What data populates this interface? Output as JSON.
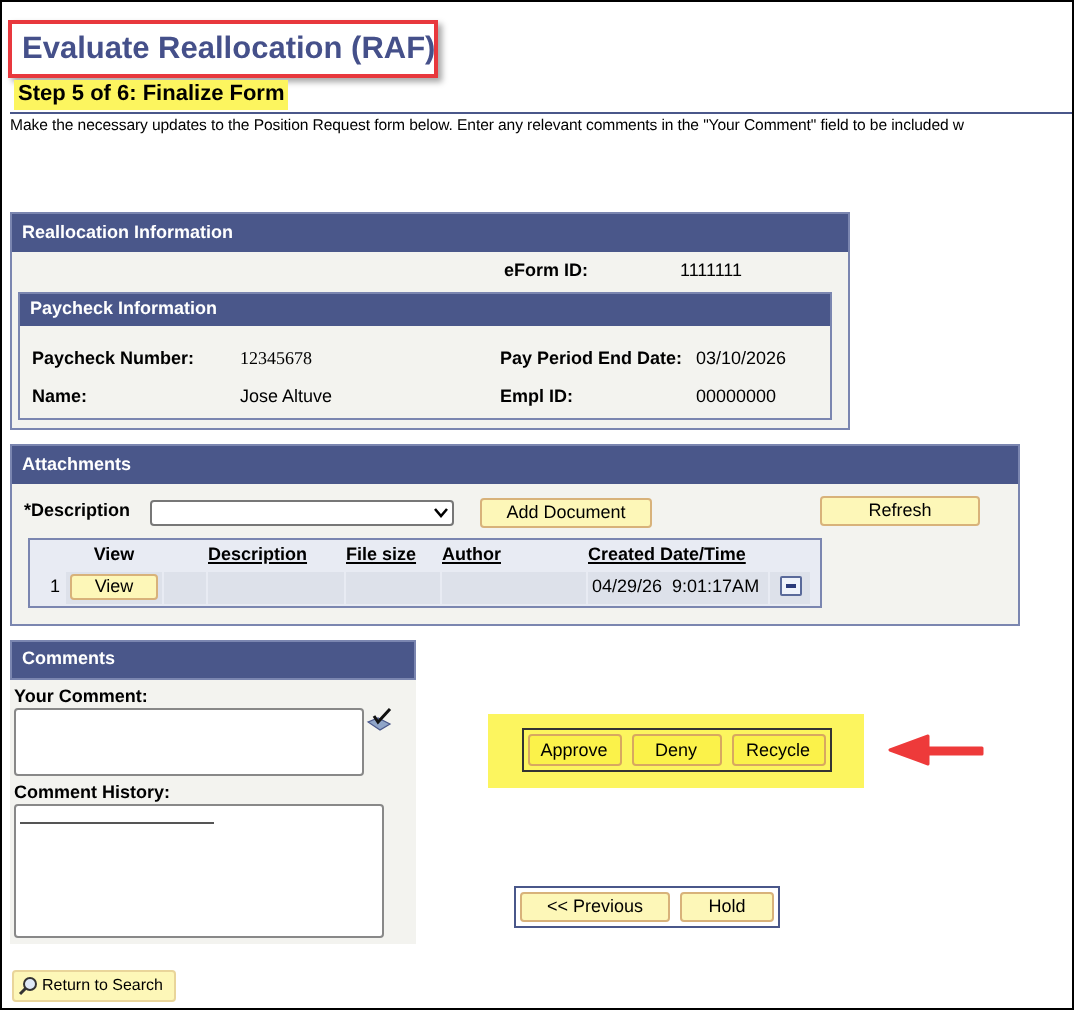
{
  "title": {
    "text": "Evaluate Reallocation (RAF)",
    "outlined": true
  },
  "step": {
    "text": "Step 5 of 6: Finalize Form",
    "highlighted": true
  },
  "instructions": "Make the necessary updates to the Position Request form below. Enter any relevant comments in the \"Your Comment\" field to be included w",
  "reallocation": {
    "heading": "Reallocation Information",
    "eform_id": {
      "label": "eForm ID:",
      "value": "1111111"
    },
    "paycheck": {
      "heading": "Paycheck Information",
      "fields": [
        {
          "label": "Paycheck Number:",
          "value": "12345678"
        },
        {
          "label": "Pay Period End Date:",
          "value": "03/10/2026"
        },
        {
          "label": "Name:",
          "value": "Jose Altuve"
        },
        {
          "label": "Empl ID:",
          "value": "00000000"
        }
      ]
    }
  },
  "attachments": {
    "heading": "Attachments",
    "description_label": "*Description",
    "add_button": "Add Document",
    "refresh_button": "Refresh",
    "table": {
      "columns": [
        {
          "label": "View",
          "link": false
        },
        {
          "label": "Description",
          "link": true
        },
        {
          "label": "File size",
          "link": true
        },
        {
          "label": "Author",
          "link": true
        },
        {
          "label": "Created Date/Time",
          "link": true
        }
      ],
      "rows": [
        {
          "number": "1",
          "view_button": "View",
          "created": "04/29/26  9:01:17AM"
        }
      ]
    }
  },
  "comments": {
    "heading": "Comments",
    "your_comment_label": "Your Comment:",
    "history_label": "Comment History:"
  },
  "actions": {
    "highlighted": true,
    "pointer_arrow": true,
    "buttons": [
      "Approve",
      "Deny",
      "Recycle"
    ]
  },
  "nav_buttons": [
    "<< Previous",
    "Hold"
  ],
  "return_button": "Return to Search"
}
